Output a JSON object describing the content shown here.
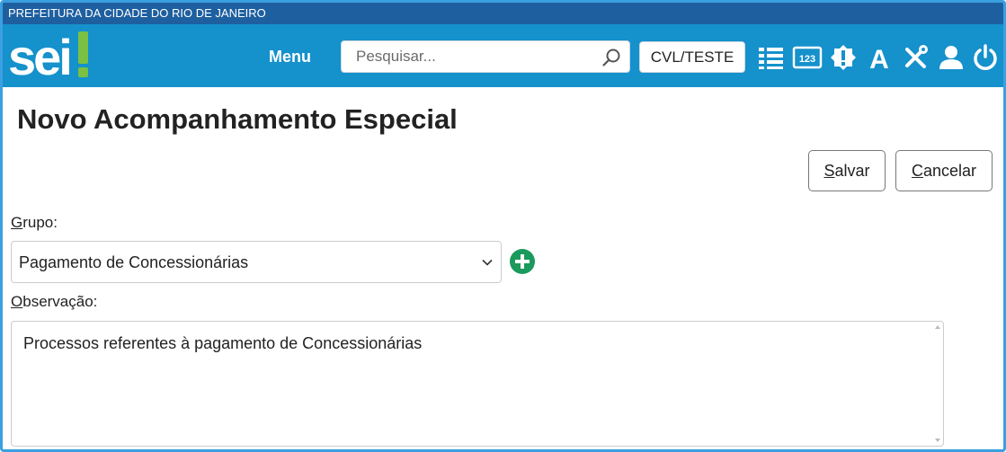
{
  "header": {
    "org_name": "PREFEITURA DA CIDADE DO RIO DE JANEIRO",
    "logo_text": "sei!",
    "menu_label": "Menu",
    "search": {
      "placeholder": "Pesquisar...",
      "value": ""
    },
    "unit_label": "CVL/TESTE",
    "icons": [
      "list-icon",
      "numbered-123-icon",
      "alert-badge-icon",
      "font-a-icon",
      "tools-icon",
      "user-icon",
      "power-icon"
    ]
  },
  "page": {
    "title": "Novo Acompanhamento Especial",
    "buttons": {
      "save": {
        "accesskey": "S",
        "rest": "alvar"
      },
      "cancel": {
        "accesskey": "C",
        "rest": "ancelar"
      }
    },
    "group": {
      "label_accesskey": "G",
      "label_rest": "rupo:",
      "selected": "Pagamento de Concessionárias"
    },
    "observation": {
      "label_accesskey": "O",
      "label_rest": "bservação:",
      "value": "Processos referentes à pagamento de Concessionárias"
    }
  },
  "colors": {
    "topbar": "#1e5fa0",
    "navbar": "#1591cc",
    "logo_accent": "#7ac143",
    "add_button": "#1a9a5c"
  }
}
